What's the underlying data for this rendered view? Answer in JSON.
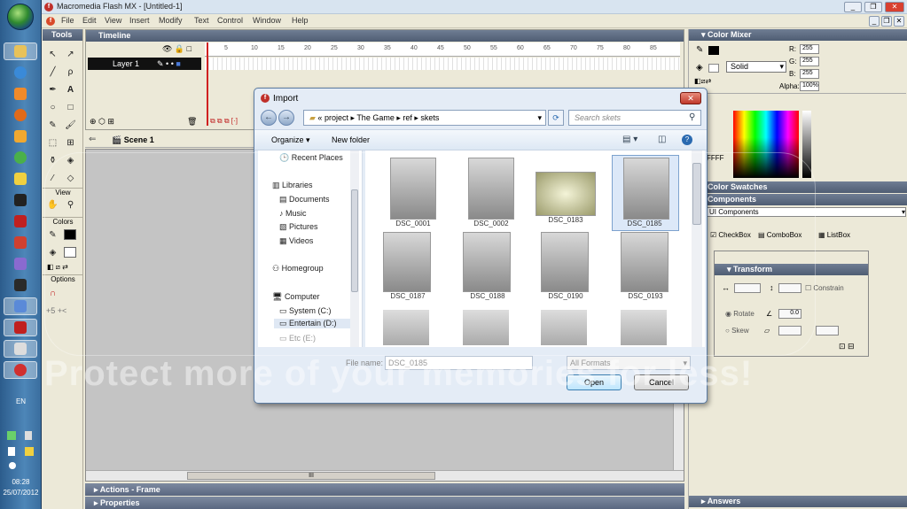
{
  "taskbar": {
    "language": "EN",
    "time": "08:28",
    "date": "25/07/2012"
  },
  "window": {
    "title": "Macromedia Flash MX - [Untitled-1]",
    "menu": [
      "File",
      "Edit",
      "View",
      "Insert",
      "Modify",
      "Text",
      "Control",
      "Window",
      "Help"
    ]
  },
  "tools": {
    "title": "Tools",
    "view_label": "View",
    "colors_label": "Colors",
    "options_label": "Options"
  },
  "timeline": {
    "title": "Timeline",
    "layer_name": "Layer 1",
    "frame_numbers": [
      "5",
      "10",
      "15",
      "20",
      "25",
      "30",
      "35",
      "40",
      "45",
      "50",
      "55",
      "60",
      "65",
      "70",
      "75",
      "80",
      "85"
    ],
    "scene": "Scene 1"
  },
  "panels": {
    "actions": "Actions - Frame",
    "properties": "Properties",
    "answers": "Answers",
    "color_mixer": "Color Mixer",
    "color_swatches": "Color Swatches",
    "components": "Components",
    "components_select": "UI Components",
    "component_items": [
      "CheckBox",
      "ComboBox",
      "ListBox"
    ],
    "transform": "Transform",
    "constrain": "Constrain",
    "rotate": "Rotate",
    "skew": "Skew",
    "rotate_value": "0.0"
  },
  "mixer": {
    "r_label": "R:",
    "r": "255",
    "g_label": "G:",
    "g": "255",
    "b_label": "B:",
    "b": "255",
    "alpha_label": "Alpha:",
    "alpha": "100%",
    "fill_type": "Solid",
    "hex": "FFFF"
  },
  "dialog": {
    "title": "Import",
    "breadcrumb": [
      "project",
      "The Game",
      "ref",
      "skets"
    ],
    "search_placeholder": "Search skets",
    "organize": "Organize",
    "new_folder": "New folder",
    "nav_items": [
      {
        "label": "Recent Places"
      },
      {
        "label": "Libraries"
      },
      {
        "label": "Documents"
      },
      {
        "label": "Music"
      },
      {
        "label": "Pictures"
      },
      {
        "label": "Videos"
      },
      {
        "label": "Homegroup"
      },
      {
        "label": "Computer"
      },
      {
        "label": "System (C:)"
      },
      {
        "label": "Entertain (D:)"
      },
      {
        "label": "Etc (E:)"
      }
    ],
    "files": [
      "DSC_0001",
      "DSC_0002",
      "DSC_0183",
      "DSC_0185",
      "DSC_0187",
      "DSC_0188",
      "DSC_0190",
      "DSC_0193"
    ],
    "filename_label": "File name:",
    "filename_value": "DSC_0185",
    "filetype": "All Formats",
    "open": "Open",
    "cancel": "Cancel"
  },
  "watermark": "Protect more of your memories for less!"
}
